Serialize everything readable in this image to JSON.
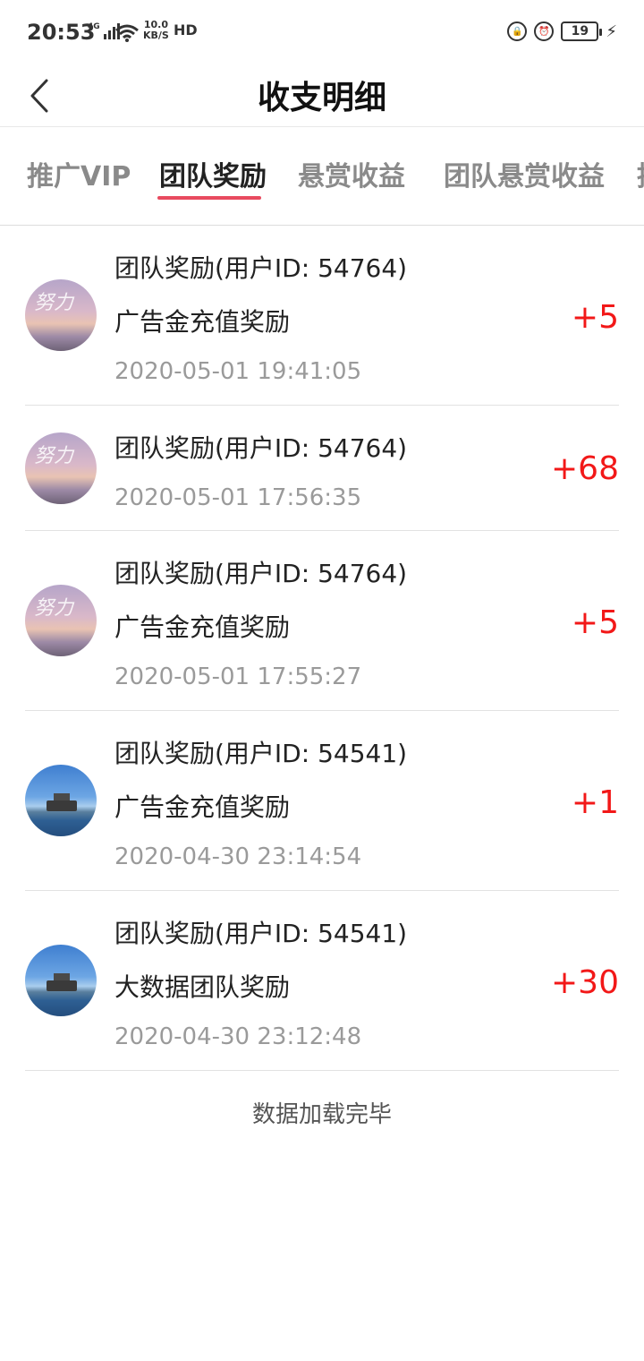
{
  "status_bar": {
    "time": "20:53",
    "network": "4G",
    "speed_value": "10.0",
    "speed_unit": "KB/S",
    "hd": "HD",
    "battery": "19"
  },
  "header": {
    "title": "收支明细"
  },
  "tabs": [
    {
      "label": "推广VIP"
    },
    {
      "label": "团队奖励",
      "active": true
    },
    {
      "label": "悬赏收益"
    },
    {
      "label": "团队悬赏收益"
    },
    {
      "label": "推"
    }
  ],
  "records": [
    {
      "title": "团队奖励(用户ID: 54764)",
      "desc": "广告金充值奖励",
      "time": "2020-05-01 19:41:05",
      "amount": "+5",
      "avatar": "dusk"
    },
    {
      "title": "团队奖励(用户ID: 54764)",
      "desc": "",
      "time": "2020-05-01 17:56:35",
      "amount": "+68",
      "avatar": "dusk"
    },
    {
      "title": "团队奖励(用户ID: 54764)",
      "desc": "广告金充值奖励",
      "time": "2020-05-01 17:55:27",
      "amount": "+5",
      "avatar": "dusk"
    },
    {
      "title": "团队奖励(用户ID: 54541)",
      "desc": "广告金充值奖励",
      "time": "2020-04-30 23:14:54",
      "amount": "+1",
      "avatar": "lake"
    },
    {
      "title": "团队奖励(用户ID: 54541)",
      "desc": "大数据团队奖励",
      "time": "2020-04-30 23:12:48",
      "amount": "+30",
      "avatar": "lake"
    }
  ],
  "footer": {
    "text": "数据加载完毕"
  },
  "colors": {
    "accent_underline": "#e84a5f",
    "amount": "#f21818"
  }
}
